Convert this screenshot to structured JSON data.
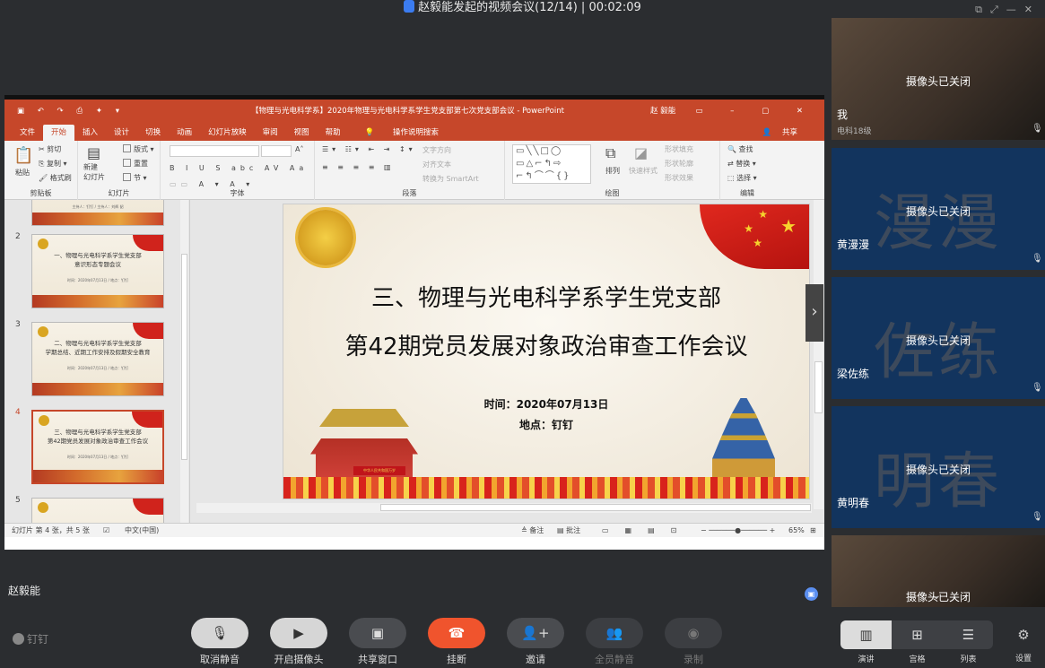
{
  "window": {
    "title": "赵毅能发起的视频会议(12/14)",
    "timer": "00:02:09"
  },
  "ppt": {
    "doc_title": "【物理与光电科学系】2020年物理与光电科学系学生党支部第七次党支部会议 - PowerPoint",
    "user": "赵 毅能",
    "tabs": [
      "文件",
      "开始",
      "插入",
      "设计",
      "切换",
      "动画",
      "幻灯片放映",
      "审阅",
      "视图",
      "帮助",
      "操作说明搜索"
    ],
    "share_label": "共享",
    "ribbon": {
      "clipboard": {
        "label": "剪贴板",
        "paste": "粘贴",
        "cut": "剪切",
        "copy": "复制",
        "format_painter": "格式刷"
      },
      "slides": {
        "label": "幻灯片",
        "new_slide": "新建\n幻灯片",
        "layout": "版式",
        "reset": "重置",
        "section": "节"
      },
      "font": {
        "label": "字体"
      },
      "paragraph": {
        "label": "段落",
        "text_direction": "文字方向",
        "align_text": "对齐文本",
        "smartart": "转换为 SmartArt"
      },
      "drawing": {
        "label": "绘图",
        "arrange": "排列",
        "quick_styles": "快速样式",
        "fill": "形状填充",
        "outline": "形状轮廓",
        "effects": "形状效果"
      },
      "editing": {
        "label": "编辑",
        "find": "查找",
        "replace": "替换",
        "select": "选择"
      }
    },
    "thumbnails": [
      {
        "num": "",
        "line1": "",
        "line2": "",
        "small": "主持人：钉钉 / 主持人：刘辉 韶"
      },
      {
        "num": "2",
        "line1": "一、物理与光电科学系学生党支部",
        "line2": "意识形态专题会议",
        "small": "时间：2020年07月13日 / 地点：钉钉"
      },
      {
        "num": "3",
        "line1": "二、物理与光电科学系学生党支部",
        "line2": "学期总结、近期工作安排及假期安全教育",
        "small": "时间：2020年07月13日 / 地点：钉钉"
      },
      {
        "num": "4",
        "line1": "三、物理与光电科学系学生党支部",
        "line2": "第42期党员发展对象政治审查工作会议",
        "small": "时间：2020年07月13日 / 地点：钉钉"
      },
      {
        "num": "5",
        "line1": "",
        "line2": "",
        "small": ""
      }
    ],
    "slide": {
      "title1": "三、物理与光电科学系学生党支部",
      "title2": "第42期党员发展对象政治审查工作会议",
      "time": "时间：2020年07月13日",
      "place": "地点：钉钉",
      "banner": "中华人民共和国万岁"
    },
    "status": {
      "slide_info": "幻灯片 第 4 张，共 5 张",
      "lang": "中文(中国)",
      "notes": "备注",
      "comments": "批注",
      "zoom": "65%"
    }
  },
  "presenter": "赵毅能",
  "participants": [
    {
      "name": "我",
      "sub": "电科18级",
      "status": "摄像头已关闭",
      "big": "",
      "photo": true
    },
    {
      "name": "黄漫漫",
      "sub": "",
      "status": "摄像头已关闭",
      "big": "漫漫",
      "photo": false
    },
    {
      "name": "梁佐练",
      "sub": "",
      "status": "摄像头已关闭",
      "big": "佐练",
      "photo": false
    },
    {
      "name": "黄明春",
      "sub": "",
      "status": "摄像头已关闭",
      "big": "明春",
      "photo": false
    },
    {
      "name": "",
      "sub": "",
      "status": "摄像头已关闭",
      "big": "",
      "photo": true
    }
  ],
  "toolbar": {
    "logo": "钉钉",
    "buttons": [
      "取消静音",
      "开启摄像头",
      "共享窗口",
      "挂断",
      "邀请",
      "全员静音",
      "录制"
    ],
    "views": [
      "演讲",
      "宫格",
      "列表"
    ],
    "settings": "设置"
  }
}
